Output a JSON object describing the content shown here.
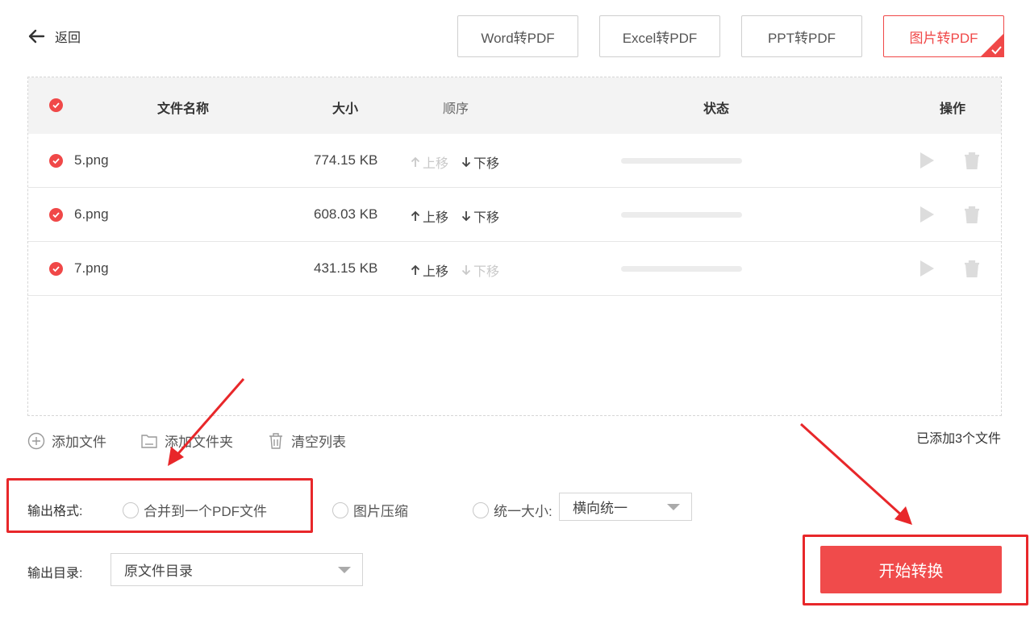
{
  "header": {
    "back_label": "返回"
  },
  "tabs": [
    {
      "label": "Word转PDF",
      "active": false
    },
    {
      "label": "Excel转PDF",
      "active": false
    },
    {
      "label": "PPT转PDF",
      "active": false
    },
    {
      "label": "图片转PDF",
      "active": true
    }
  ],
  "table": {
    "columns": {
      "name": "文件名称",
      "size": "大小",
      "order": "顺序",
      "status": "状态",
      "actions": "操作"
    },
    "move_up_label": "上移",
    "move_down_label": "下移",
    "rows": [
      {
        "name": "5.png",
        "size": "774.15 KB",
        "up_enabled": false,
        "down_enabled": true,
        "progress": 0
      },
      {
        "name": "6.png",
        "size": "608.03 KB",
        "up_enabled": true,
        "down_enabled": true,
        "progress": 0
      },
      {
        "name": "7.png",
        "size": "431.15 KB",
        "up_enabled": true,
        "down_enabled": false,
        "progress": 0
      }
    ]
  },
  "toolbar": {
    "add_file": "添加文件",
    "add_folder": "添加文件夹",
    "clear_list": "清空列表"
  },
  "file_count": "已添加3个文件",
  "output": {
    "format_label": "输出格式:",
    "options": {
      "merge": "合并到一个PDF文件",
      "compress": "图片压缩",
      "uniform": "统一大小:"
    },
    "uniform_select": "横向统一",
    "dir_label": "输出目录:",
    "dir_select": "原文件目录"
  },
  "start_button": "开始转换",
  "colors": {
    "accent": "#f04848",
    "annotation": "#e8272a"
  }
}
